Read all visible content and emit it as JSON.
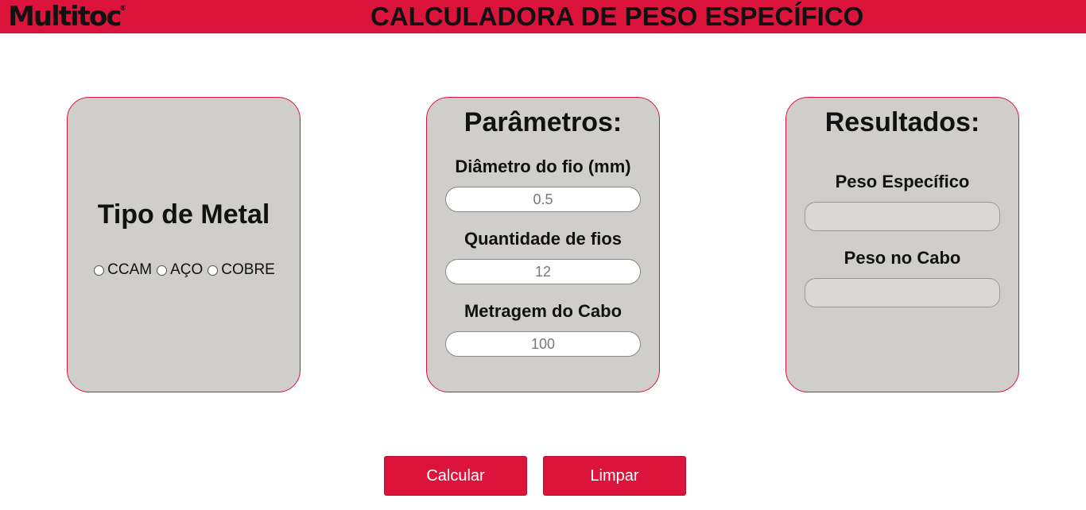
{
  "header": {
    "logo_text": "Multitoc",
    "logo_mark": "®",
    "title": "CALCULADORA DE PESO ESPECÍFICO",
    "background_color": "#dc143c"
  },
  "metal_card": {
    "title": "Tipo de Metal",
    "options": [
      {
        "label": "CCAM",
        "checked": false
      },
      {
        "label": "AÇO",
        "checked": false
      },
      {
        "label": "COBRE",
        "checked": false
      }
    ]
  },
  "params_card": {
    "title": "Parâmetros:",
    "fields": [
      {
        "label": "Diâmetro do fio (mm)",
        "placeholder": "0.5"
      },
      {
        "label": "Quantidade de fios",
        "placeholder": "12"
      },
      {
        "label": "Metragem do Cabo",
        "placeholder": "100"
      }
    ]
  },
  "results_card": {
    "title": "Resultados:",
    "fields": [
      {
        "label": "Peso Específico",
        "value": ""
      },
      {
        "label": "Peso no Cabo",
        "value": ""
      }
    ]
  },
  "actions": {
    "calculate_label": "Calcular",
    "clear_label": "Limpar"
  },
  "colors": {
    "accent": "#dc143c",
    "card_bg": "#d0cecb"
  }
}
